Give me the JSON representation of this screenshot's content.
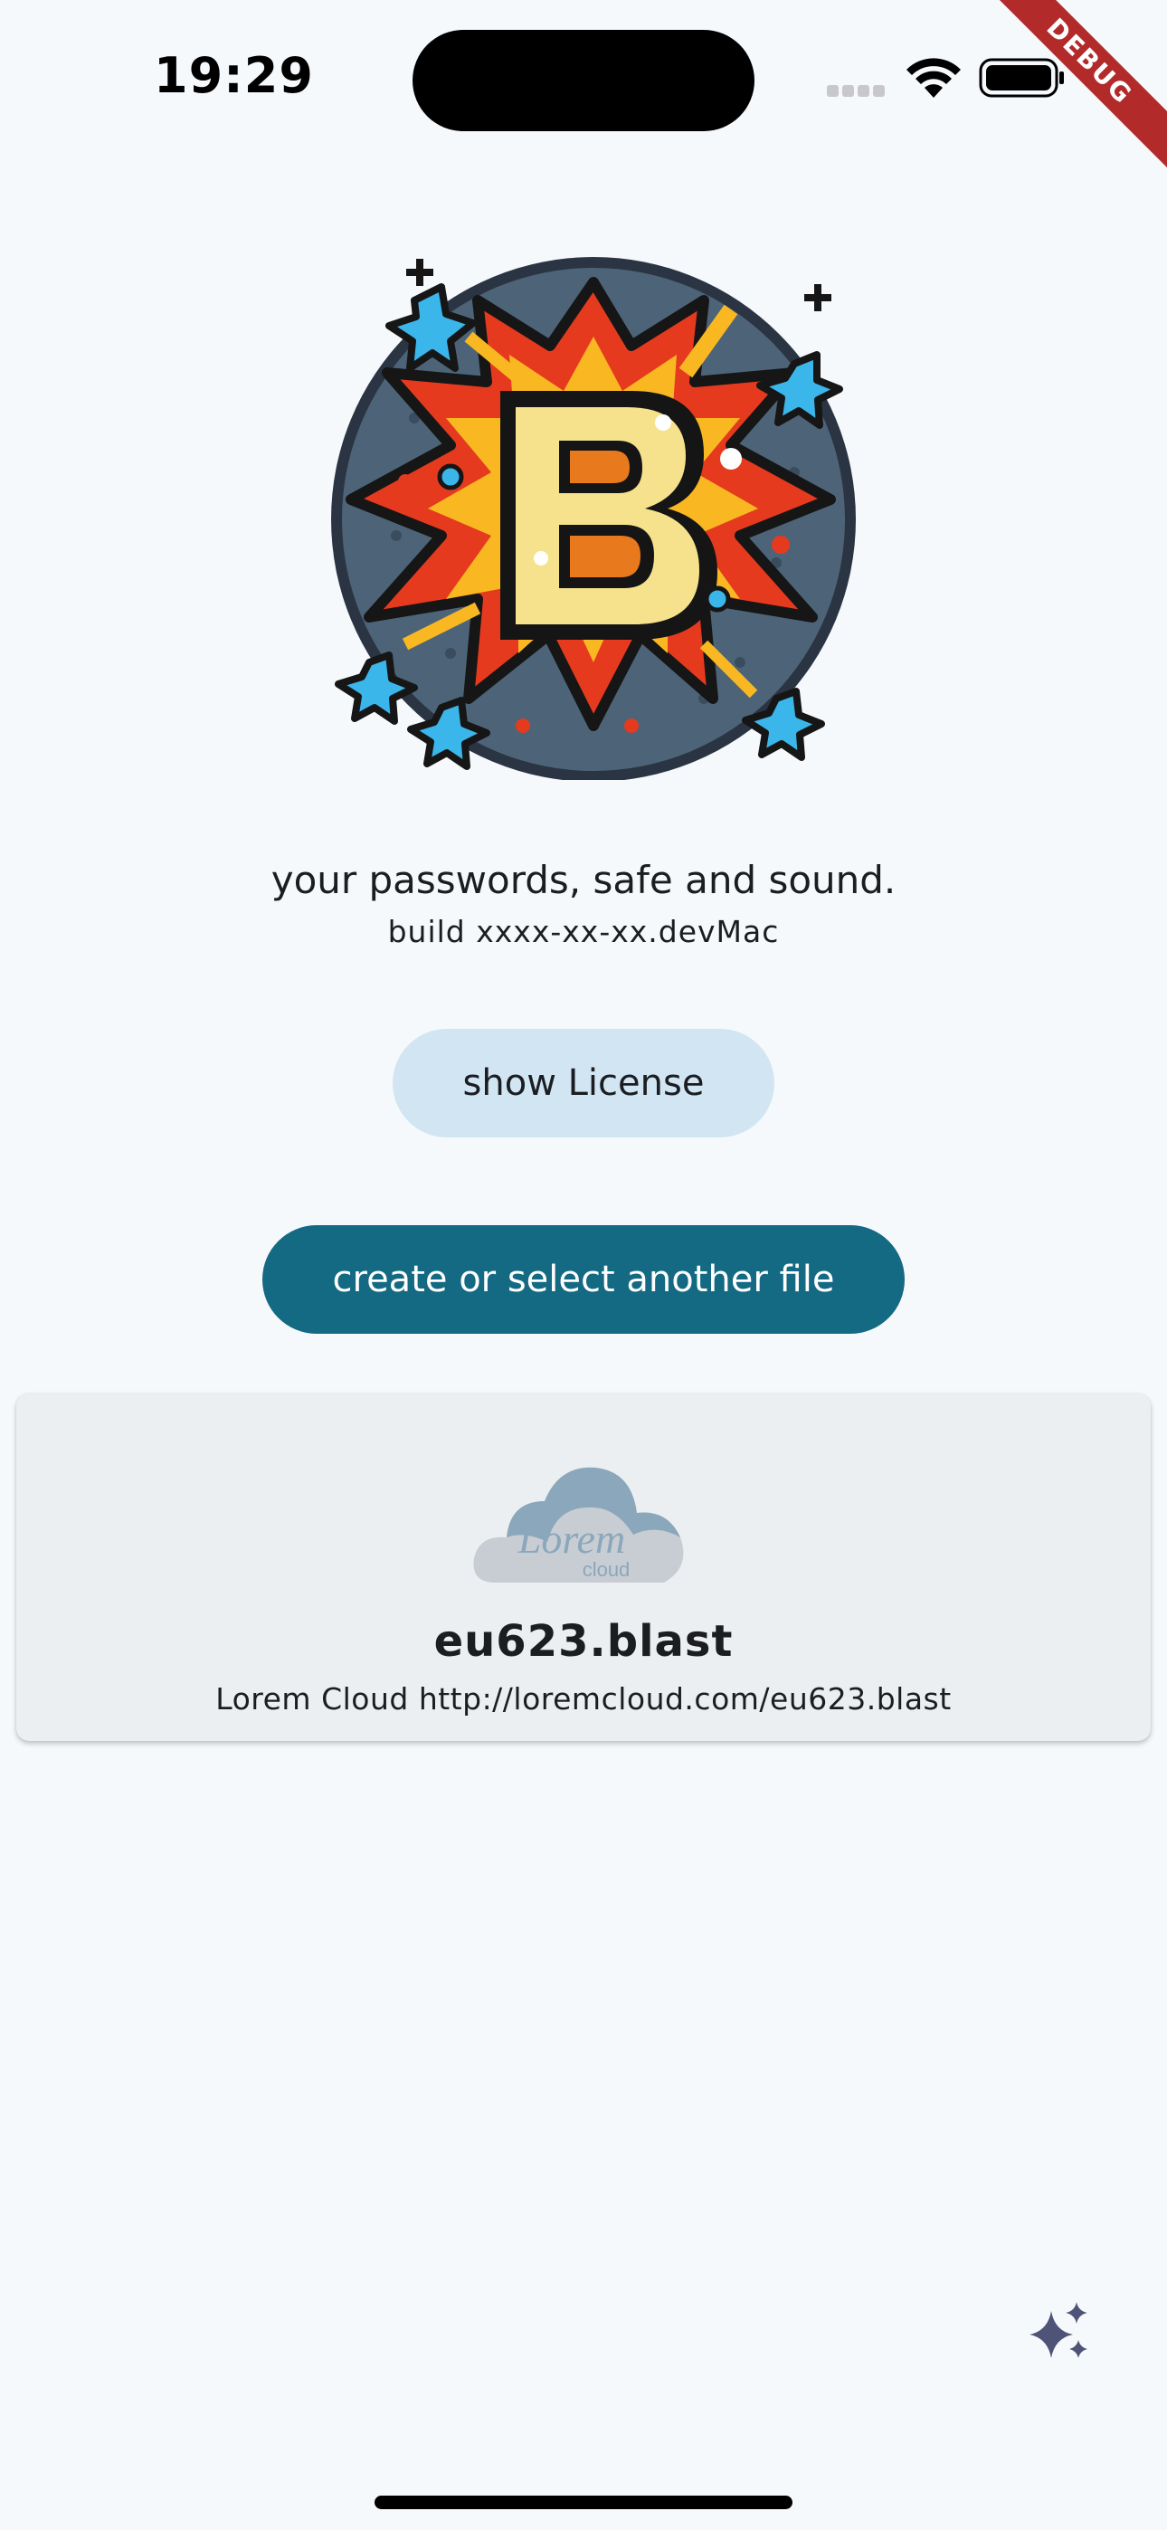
{
  "status_bar": {
    "time": "19:29",
    "icons": [
      "signal-icon",
      "wifi-icon",
      "battery-icon"
    ]
  },
  "debug_banner": "DEBUG",
  "app": {
    "logo_icon": "blast-logo-icon",
    "tagline": "your passwords, safe and sound.",
    "build": "build xxxx-xx-xx.devMac"
  },
  "actions": {
    "license_label": "show License",
    "create_label": "create or select another file"
  },
  "recent_file": {
    "provider_logo_text": "Lorem",
    "provider_logo_subtext": "cloud",
    "name": "eu623.blast",
    "location": "Lorem Cloud http://loremcloud.com/eu623.blast"
  },
  "fab_icon": "sparkle-icon",
  "colors": {
    "background": "#f6f9fc",
    "primary": "#146983",
    "secondary_container": "#d1e5f3",
    "card": "#eceff2",
    "debug": "#b32a2a"
  }
}
